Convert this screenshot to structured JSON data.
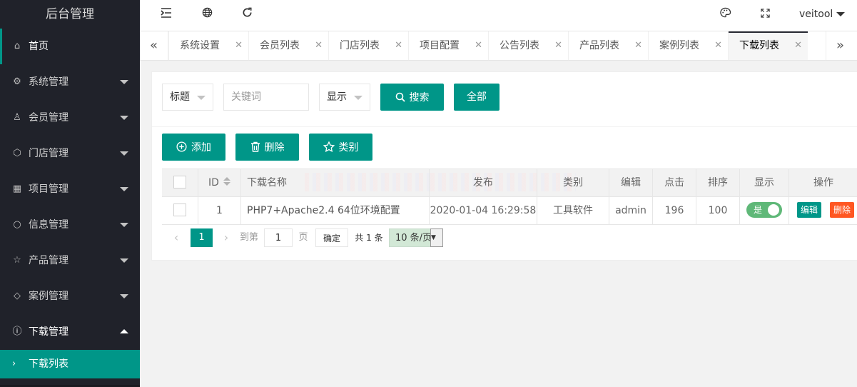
{
  "sidebar": {
    "logo": "后台管理",
    "items": [
      {
        "label": "首页",
        "icon": "home-icon"
      },
      {
        "label": "系统管理",
        "icon": "gear-icon"
      },
      {
        "label": "会员管理",
        "icon": "user-icon"
      },
      {
        "label": "门店管理",
        "icon": "box-icon"
      },
      {
        "label": "项目管理",
        "icon": "grid-icon"
      },
      {
        "label": "信息管理",
        "icon": "circle-icon"
      },
      {
        "label": "产品管理",
        "icon": "star-icon"
      },
      {
        "label": "案例管理",
        "icon": "diamond-icon"
      },
      {
        "label": "下载管理",
        "icon": "info-icon"
      }
    ],
    "sub_item": {
      "label": "下载列表",
      "icon": "chevron-right-icon"
    }
  },
  "header": {
    "icons": [
      "menu-fold-icon",
      "globe-icon",
      "refresh-icon",
      "theme-icon",
      "fullscreen-icon"
    ],
    "user": "veitool"
  },
  "tabs": {
    "items": [
      "系统设置",
      "会员列表",
      "门店列表",
      "项目配置",
      "公告列表",
      "产品列表",
      "案例列表",
      "下载列表"
    ],
    "active": "下载列表"
  },
  "search": {
    "field_select": "标题",
    "keyword_placeholder": "关键词",
    "display_select": "显示",
    "search_label": "搜索",
    "all_label": "全部"
  },
  "toolbar": {
    "add_label": "添加",
    "delete_label": "删除",
    "category_label": "类别"
  },
  "table": {
    "columns": [
      "ID",
      "下载名称",
      "发布",
      "类别",
      "编辑",
      "点击",
      "排序",
      "显示",
      "操作"
    ],
    "rows": [
      {
        "id": "1",
        "name": "PHP7+Apache2.4 64位环境配置",
        "publish": "2020-01-04 16:29:58",
        "category": "工具软件",
        "editor": "admin",
        "clicks": "196",
        "sort": "100",
        "display": "是",
        "display_on": true,
        "edit_label": "编辑",
        "delete_label": "删除"
      }
    ]
  },
  "pager": {
    "current": "1",
    "goto_label": "到第",
    "goto_value": "1",
    "page_unit": "页",
    "confirm_label": "确定",
    "total": "共 1 条",
    "limit": "10 条/页"
  },
  "colors": {
    "primary": "#009688",
    "sidebar_bg": "#20222a",
    "danger": "#ff5722",
    "switch_on": "#5fb878"
  }
}
